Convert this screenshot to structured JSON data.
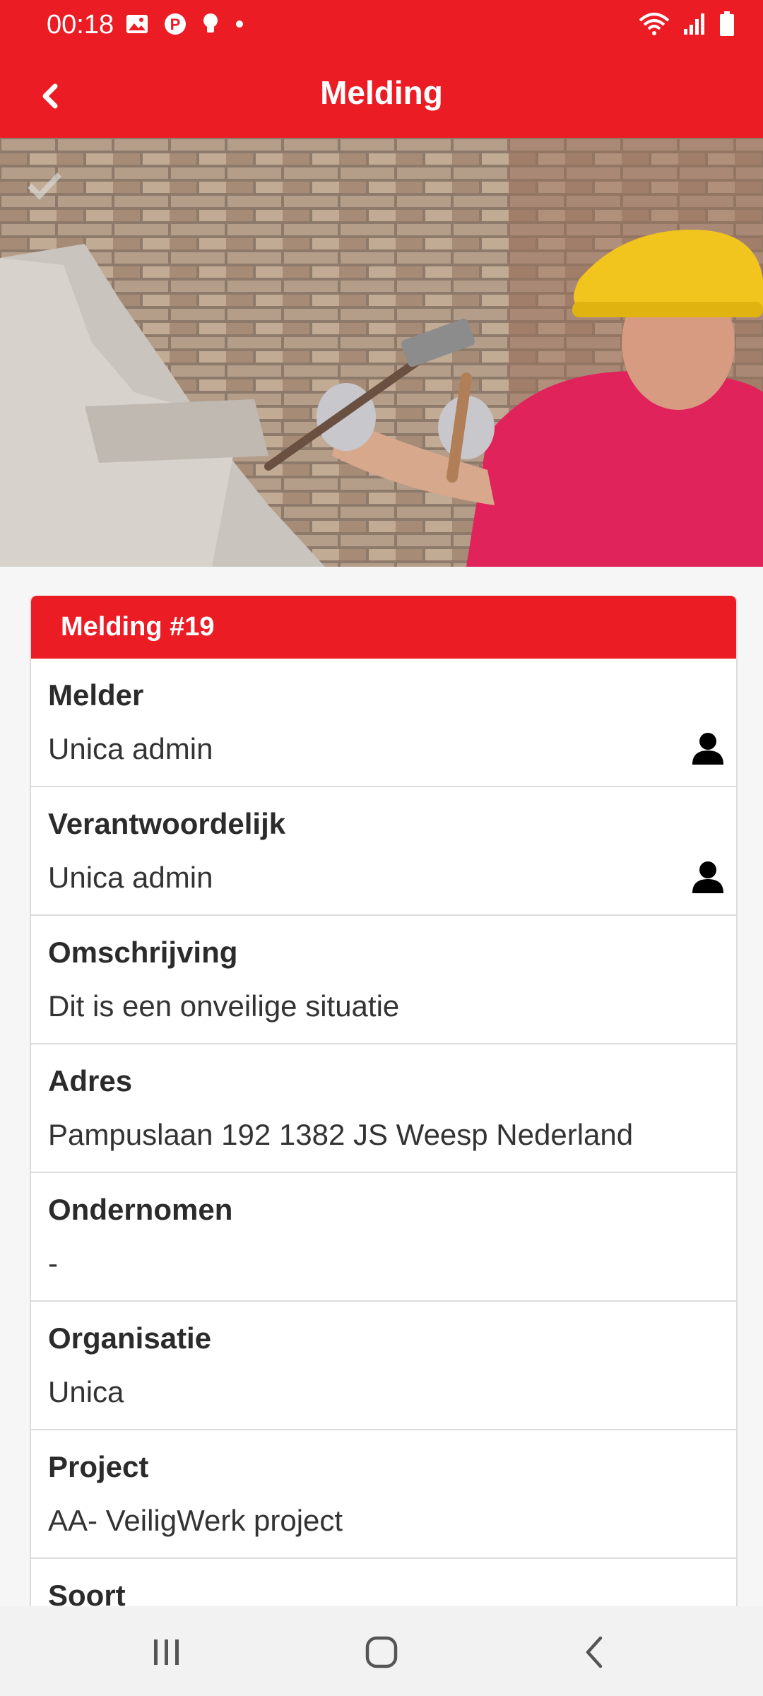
{
  "status_bar": {
    "time": "00:18",
    "left_icons": [
      "image-icon",
      "pinterest-icon",
      "lightbulb-icon",
      "dot-icon"
    ],
    "right_icons": [
      "wifi-icon",
      "signal-icon",
      "battery-icon"
    ]
  },
  "header": {
    "title": "Melding"
  },
  "card": {
    "title": "Melding #19",
    "fields": [
      {
        "label": "Melder",
        "value": "Unica admin",
        "icon": "person-icon"
      },
      {
        "label": "Verantwoordelijk",
        "value": "Unica admin",
        "icon": "person-icon"
      },
      {
        "label": "Omschrijving",
        "value": "Dit is een onveilige situatie"
      },
      {
        "label": "Adres",
        "value": "Pampuslaan 192 1382 JS Weesp Nederland"
      },
      {
        "label": "Ondernomen",
        "value": "-"
      },
      {
        "label": "Organisatie",
        "value": "Unica"
      },
      {
        "label": "Project",
        "value": "AA- VeiligWerk project"
      },
      {
        "label": "Soort",
        "value": ""
      }
    ]
  },
  "colors": {
    "brand": "#ec1c24",
    "background": "#f6f6f6",
    "divider": "#dcdcdc",
    "text": "#2b2b2b"
  },
  "nav_bar": {
    "buttons": [
      "recents-icon",
      "home-icon",
      "back-icon"
    ]
  }
}
